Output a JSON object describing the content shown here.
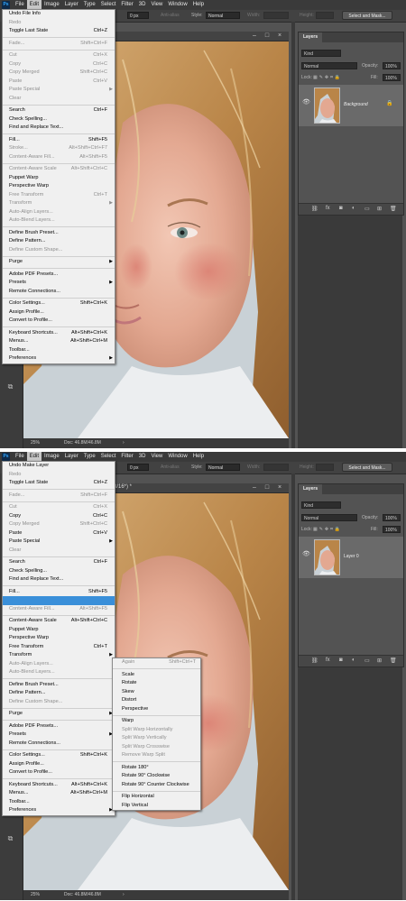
{
  "colors": {
    "app_bg": "#535353",
    "menubar": "#3a3a3a",
    "dropdown": "#f0f0f0",
    "highlight": "#3a8fd9",
    "hair": "#c89a5a",
    "skin": "#e9b6a2"
  },
  "top": {
    "app_logo": "Ps",
    "menubar": [
      "File",
      "Edit",
      "Image",
      "Layer",
      "Type",
      "Select",
      "Filter",
      "3D",
      "View",
      "Window",
      "Help"
    ],
    "options": {
      "feather_value": "0 px",
      "anti_alias": "Anti-alias",
      "style_label": "Style:",
      "style_value": "Normal",
      "width_label": "Width:",
      "height_label": "Height:",
      "select_mask": "Select and Mask..."
    },
    "doc_title": "",
    "status": {
      "zoom": "25%",
      "doc": "Doc: 46.8M/46.8M"
    },
    "layers": {
      "tab": "Layers",
      "kind": "Kind",
      "blend": "Normal",
      "opacity_label": "Opacity:",
      "opacity_value": "100%",
      "lock_label": "Lock:",
      "fill_label": "Fill:",
      "fill_value": "100%",
      "layer_name": "Background"
    },
    "edit_menu": [
      {
        "label": "Undo File Info",
        "shortcut": "",
        "disabled": false
      },
      {
        "label": "Redo",
        "shortcut": "",
        "disabled": true
      },
      {
        "label": "Toggle Last State",
        "shortcut": "Ctrl+Z",
        "disabled": false
      },
      {
        "sep": true
      },
      {
        "label": "Fade...",
        "shortcut": "Shift+Ctrl+F",
        "disabled": true
      },
      {
        "sep": true
      },
      {
        "label": "Cut",
        "shortcut": "Ctrl+X",
        "disabled": true
      },
      {
        "label": "Copy",
        "shortcut": "Ctrl+C",
        "disabled": true
      },
      {
        "label": "Copy Merged",
        "shortcut": "Shift+Ctrl+C",
        "disabled": true
      },
      {
        "label": "Paste",
        "shortcut": "Ctrl+V",
        "disabled": true
      },
      {
        "label": "Paste Special",
        "shortcut": "",
        "disabled": true,
        "arrow": true
      },
      {
        "label": "Clear",
        "shortcut": "",
        "disabled": true
      },
      {
        "sep": true
      },
      {
        "label": "Search",
        "shortcut": "Ctrl+F",
        "disabled": false
      },
      {
        "label": "Check Spelling...",
        "shortcut": "",
        "disabled": false
      },
      {
        "label": "Find and Replace Text...",
        "shortcut": "",
        "disabled": false
      },
      {
        "sep": true
      },
      {
        "label": "Fill...",
        "shortcut": "Shift+F5",
        "disabled": false
      },
      {
        "label": "Stroke...",
        "shortcut": "Alt+Shift+Ctrl+F7",
        "disabled": true
      },
      {
        "label": "Content-Aware Fill...",
        "shortcut": "Alt+Shift+F5",
        "disabled": true
      },
      {
        "sep": true
      },
      {
        "label": "Content-Aware Scale",
        "shortcut": "Alt+Shift+Ctrl+C",
        "disabled": true
      },
      {
        "label": "Puppet Warp",
        "shortcut": "",
        "disabled": false
      },
      {
        "label": "Perspective Warp",
        "shortcut": "",
        "disabled": false
      },
      {
        "label": "Free Transform",
        "shortcut": "Ctrl+T",
        "disabled": true
      },
      {
        "label": "Transform",
        "shortcut": "",
        "disabled": true,
        "arrow": true
      },
      {
        "label": "Auto-Align Layers...",
        "shortcut": "",
        "disabled": true
      },
      {
        "label": "Auto-Blend Layers...",
        "shortcut": "",
        "disabled": true
      },
      {
        "sep": true
      },
      {
        "label": "Define Brush Preset...",
        "shortcut": "",
        "disabled": false
      },
      {
        "label": "Define Pattern...",
        "shortcut": "",
        "disabled": false
      },
      {
        "label": "Define Custom Shape...",
        "shortcut": "",
        "disabled": true
      },
      {
        "sep": true
      },
      {
        "label": "Purge",
        "shortcut": "",
        "disabled": false,
        "arrow": true
      },
      {
        "sep": true
      },
      {
        "label": "Adobe PDF Presets...",
        "shortcut": "",
        "disabled": false
      },
      {
        "label": "Presets",
        "shortcut": "",
        "disabled": false,
        "arrow": true
      },
      {
        "label": "Remote Connections...",
        "shortcut": "",
        "disabled": false
      },
      {
        "sep": true
      },
      {
        "label": "Color Settings...",
        "shortcut": "Shift+Ctrl+K",
        "disabled": false
      },
      {
        "label": "Assign Profile...",
        "shortcut": "",
        "disabled": false
      },
      {
        "label": "Convert to Profile...",
        "shortcut": "",
        "disabled": false
      },
      {
        "sep": true
      },
      {
        "label": "Keyboard Shortcuts...",
        "shortcut": "Alt+Shift+Ctrl+K",
        "disabled": false
      },
      {
        "label": "Menus...",
        "shortcut": "Alt+Shift+Ctrl+M",
        "disabled": false
      },
      {
        "label": "Toolbar...",
        "shortcut": "",
        "disabled": false
      },
      {
        "label": "Preferences",
        "shortcut": "",
        "disabled": false,
        "arrow": true
      }
    ]
  },
  "bottom": {
    "app_logo": "Ps",
    "menubar": [
      "File",
      "Edit",
      "Image",
      "Layer",
      "Type",
      "Select",
      "Filter",
      "3D",
      "View",
      "Window",
      "Help"
    ],
    "options": {
      "feather_value": "0 px",
      "anti_alias": "Anti-alias",
      "style_label": "Style:",
      "style_value": "Normal",
      "width_label": "Width:",
      "height_label": "Height:",
      "select_mask": "Select and Mask..."
    },
    "doc_title": "8/16*) *",
    "status": {
      "zoom": "25%",
      "doc": "Doc: 46.8M/46.8M"
    },
    "layers": {
      "tab": "Layers",
      "kind": "Kind",
      "blend": "Normal",
      "opacity_label": "Opacity:",
      "opacity_value": "100%",
      "lock_label": "Lock:",
      "fill_label": "Fill:",
      "fill_value": "100%",
      "layer_name": "Layer 0"
    },
    "edit_menu": [
      {
        "label": "Undo Make Layer",
        "shortcut": "",
        "disabled": false
      },
      {
        "label": "Redo",
        "shortcut": "",
        "disabled": true
      },
      {
        "label": "Toggle Last State",
        "shortcut": "Ctrl+Z",
        "disabled": false
      },
      {
        "sep": true
      },
      {
        "label": "Fade...",
        "shortcut": "Shift+Ctrl+F",
        "disabled": true
      },
      {
        "sep": true
      },
      {
        "label": "Cut",
        "shortcut": "Ctrl+X",
        "disabled": true
      },
      {
        "label": "Copy",
        "shortcut": "Ctrl+C",
        "disabled": false
      },
      {
        "label": "Copy Merged",
        "shortcut": "Shift+Ctrl+C",
        "disabled": true
      },
      {
        "label": "Paste",
        "shortcut": "Ctrl+V",
        "disabled": false
      },
      {
        "label": "Paste Special",
        "shortcut": "",
        "disabled": false,
        "arrow": true
      },
      {
        "label": "Clear",
        "shortcut": "",
        "disabled": true
      },
      {
        "sep": true
      },
      {
        "label": "Search",
        "shortcut": "Ctrl+F",
        "disabled": false
      },
      {
        "label": "Check Spelling...",
        "shortcut": "",
        "disabled": false
      },
      {
        "label": "Find and Replace Text...",
        "shortcut": "",
        "disabled": false
      },
      {
        "sep": true
      },
      {
        "label": "Fill...",
        "shortcut": "Shift+F5",
        "disabled": false
      },
      {
        "label": "",
        "shortcut": "",
        "disabled": false,
        "highlight": true
      },
      {
        "label": "Content-Aware Fill...",
        "shortcut": "Alt+Shift+F5",
        "disabled": true
      },
      {
        "sep": true
      },
      {
        "label": "Content-Aware Scale",
        "shortcut": "Alt+Shift+Ctrl+C",
        "disabled": false
      },
      {
        "label": "Puppet Warp",
        "shortcut": "",
        "disabled": false
      },
      {
        "label": "Perspective Warp",
        "shortcut": "",
        "disabled": false
      },
      {
        "label": "Free Transform",
        "shortcut": "Ctrl+T",
        "disabled": false
      },
      {
        "label": "Transform",
        "shortcut": "",
        "disabled": false,
        "arrow": true
      },
      {
        "label": "Auto-Align Layers...",
        "shortcut": "",
        "disabled": true
      },
      {
        "label": "Auto-Blend Layers...",
        "shortcut": "",
        "disabled": true
      },
      {
        "sep": true
      },
      {
        "label": "Define Brush Preset...",
        "shortcut": "",
        "disabled": false
      },
      {
        "label": "Define Pattern...",
        "shortcut": "",
        "disabled": false
      },
      {
        "label": "Define Custom Shape...",
        "shortcut": "",
        "disabled": true
      },
      {
        "sep": true
      },
      {
        "label": "Purge",
        "shortcut": "",
        "disabled": false,
        "arrow": true
      },
      {
        "sep": true
      },
      {
        "label": "Adobe PDF Presets...",
        "shortcut": "",
        "disabled": false
      },
      {
        "label": "Presets",
        "shortcut": "",
        "disabled": false,
        "arrow": true
      },
      {
        "label": "Remote Connections...",
        "shortcut": "",
        "disabled": false
      },
      {
        "sep": true
      },
      {
        "label": "Color Settings...",
        "shortcut": "Shift+Ctrl+K",
        "disabled": false
      },
      {
        "label": "Assign Profile...",
        "shortcut": "",
        "disabled": false
      },
      {
        "label": "Convert to Profile...",
        "shortcut": "",
        "disabled": false
      },
      {
        "sep": true
      },
      {
        "label": "Keyboard Shortcuts...",
        "shortcut": "Alt+Shift+Ctrl+K",
        "disabled": false
      },
      {
        "label": "Menus...",
        "shortcut": "Alt+Shift+Ctrl+M",
        "disabled": false
      },
      {
        "label": "Toolbar...",
        "shortcut": "",
        "disabled": false
      },
      {
        "label": "Preferences",
        "shortcut": "",
        "disabled": false,
        "arrow": true
      }
    ],
    "transform_submenu": [
      {
        "label": "Again",
        "shortcut": "Shift+Ctrl+T",
        "disabled": true
      },
      {
        "sep": true
      },
      {
        "label": "Scale",
        "shortcut": "",
        "disabled": false
      },
      {
        "label": "Rotate",
        "shortcut": "",
        "disabled": false
      },
      {
        "label": "Skew",
        "shortcut": "",
        "disabled": false
      },
      {
        "label": "Distort",
        "shortcut": "",
        "disabled": false
      },
      {
        "label": "Perspective",
        "shortcut": "",
        "disabled": false
      },
      {
        "sep": true
      },
      {
        "label": "Warp",
        "shortcut": "",
        "disabled": false
      },
      {
        "label": "Split Warp Horizontally",
        "shortcut": "",
        "disabled": true
      },
      {
        "label": "Split Warp Vertically",
        "shortcut": "",
        "disabled": true
      },
      {
        "label": "Split Warp Crosswise",
        "shortcut": "",
        "disabled": true
      },
      {
        "label": "Remove Warp Split",
        "shortcut": "",
        "disabled": true
      },
      {
        "sep": true
      },
      {
        "label": "Rotate 180°",
        "shortcut": "",
        "disabled": false
      },
      {
        "label": "Rotate 90° Clockwise",
        "shortcut": "",
        "disabled": false
      },
      {
        "label": "Rotate 90° Counter Clockwise",
        "shortcut": "",
        "disabled": false
      },
      {
        "sep": true
      },
      {
        "label": "Flip Horizontal",
        "shortcut": "",
        "disabled": false
      },
      {
        "label": "Flip Vertical",
        "shortcut": "",
        "disabled": false
      }
    ]
  }
}
